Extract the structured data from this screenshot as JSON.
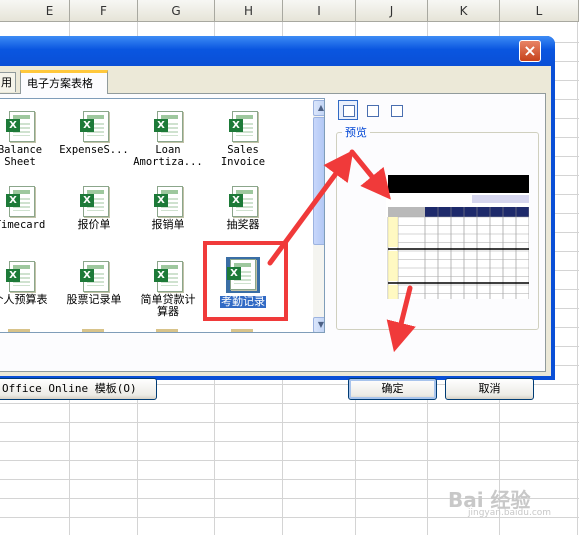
{
  "sheet": {
    "columns": [
      "E",
      "F",
      "G",
      "H",
      "I",
      "J",
      "K",
      "L"
    ]
  },
  "dialog": {
    "close_label": "×",
    "tabs": {
      "prev_label": "用",
      "active_label": "电子方案表格"
    },
    "templates": [
      {
        "label": "Balance\nSheet"
      },
      {
        "label": "ExpenseS..."
      },
      {
        "label": "Loan\nAmortiza..."
      },
      {
        "label": "Sales\nInvoice"
      },
      {
        "label": "Timecard"
      },
      {
        "label": "报价单"
      },
      {
        "label": "报销单"
      },
      {
        "label": "抽奖器"
      },
      {
        "label": "个人预算表"
      },
      {
        "label": "股票记录单"
      },
      {
        "label": "简单贷款计\n算器"
      },
      {
        "label": "考勤记录"
      }
    ],
    "preview": {
      "label": "预览"
    },
    "buttons": {
      "online": "Office Online 模板(O)",
      "ok": "确定",
      "cancel": "取消"
    }
  },
  "watermark": {
    "text": "Bai 经验",
    "sub": "jingyan.baidu.com"
  },
  "colors": {
    "annotation": "#f03a3a",
    "title_bar": "#0a4fd6",
    "selection": "#316ac5"
  }
}
